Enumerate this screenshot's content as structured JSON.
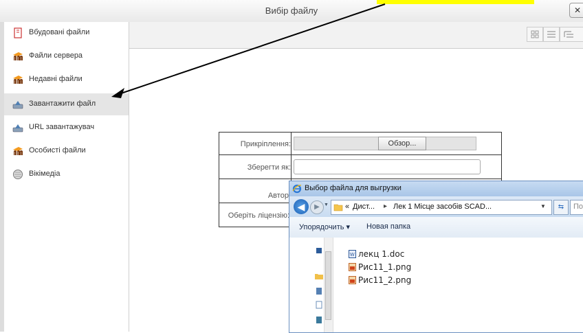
{
  "dialog": {
    "title": "Вибір файлу",
    "close_label": "✕"
  },
  "sidebar": {
    "items": [
      {
        "label": "Вбудовані файли",
        "icon": "embedded-files-icon"
      },
      {
        "label": "Файли сервера",
        "icon": "moodle-icon"
      },
      {
        "label": "Недавні файли",
        "icon": "moodle-icon"
      },
      {
        "label": "Завантажити файл",
        "icon": "upload-icon",
        "active": true
      },
      {
        "label": "URL завантажувач",
        "icon": "url-download-icon"
      },
      {
        "label": "Особисті файли",
        "icon": "moodle-icon"
      },
      {
        "label": "Вікімедіа",
        "icon": "wikimedia-icon"
      }
    ]
  },
  "form": {
    "attachment_label": "Прикріплення:",
    "browse_button": "Обзор...",
    "save_as_label": "Зберегти як:",
    "save_as_value": "",
    "author_label": "Автор:",
    "license_label": "Оберіть ліцензію:"
  },
  "file_dialog": {
    "title": "Выбор файла для выгрузки",
    "path_root": "«",
    "path_part1": "Дист...",
    "path_sep": "▸",
    "path_part2": "Лек 1 Місце засобів SCAD...",
    "search_placeholder": "По",
    "organize_label": "Упорядочить ▾",
    "new_folder_label": "Новая папка",
    "files": [
      "лекц 1.doc",
      "Рис11_1.png",
      "Рис11_2.png"
    ]
  },
  "colors": {
    "highlight": "#ffff00",
    "active_item": "#e5e5e5",
    "dialog_border": "#6a8fbf"
  }
}
